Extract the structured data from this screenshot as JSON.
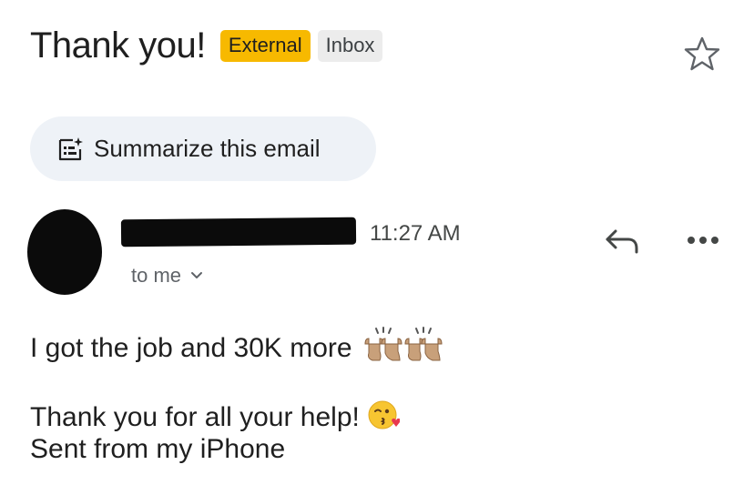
{
  "email": {
    "subject": "Thank you!",
    "labels": {
      "external": "External",
      "inbox": "Inbox"
    },
    "summarize_label": "Summarize this email",
    "time": "11:27 AM",
    "recipients": "to me",
    "body": {
      "line1": "I got the job and 30K more",
      "line1_emoji": "raising-hands-emoji",
      "line2": "Thank you for all your help!",
      "line2_emoji": "kissing-face-emoji",
      "line3": "Sent from my iPhone"
    }
  },
  "colors": {
    "external_badge": "#f7b900",
    "inbox_badge": "#ececec",
    "summarize_bg": "#eef2f7",
    "text": "#1f1f1f",
    "secondary_text": "#5f6368"
  },
  "icons": {
    "star": "star-icon",
    "summarize": "summarize-sparkle-icon",
    "reply": "reply-icon",
    "more": "more-horizontal-icon",
    "chevron": "chevron-down-icon"
  }
}
